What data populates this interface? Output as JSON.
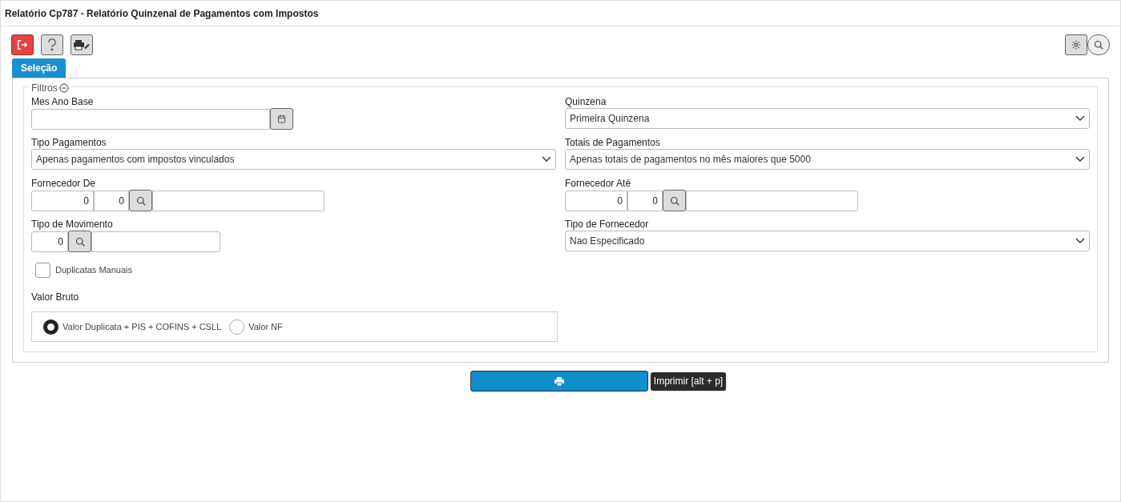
{
  "window": {
    "title": "Relatório Cp787 - Relatório Quinzenal de Pagamentos com Impostos"
  },
  "toolbar": [
    {
      "kind": "exit"
    },
    {
      "kind": "help"
    },
    {
      "kind": "printer-settings"
    }
  ],
  "toolbar_right": [
    {
      "kind": "settings"
    },
    {
      "kind": "search"
    }
  ],
  "tabs": [
    {
      "label": "Seleção",
      "selected": true
    }
  ],
  "filters": {
    "legend": "Filtros",
    "expanded": true,
    "rows": [
      [
        {
          "kind": "date",
          "label": "Mes Ano Base"
        },
        {
          "kind": "select",
          "label": "Quinzena",
          "value": "Primeira Quinzena"
        }
      ],
      [
        {
          "kind": "select",
          "label": "Tipo Pagamentos",
          "value": "Apenas pagamentos com impostos vinculados"
        },
        {
          "kind": "select",
          "label": "Totais de Pagamentos",
          "value": "Apenas totais de pagamentos no mês maiores que 5000"
        }
      ],
      [
        {
          "kind": "lookup2",
          "label": "Fornecedor De",
          "values": [
            "0",
            "0"
          ]
        },
        {
          "kind": "lookup2",
          "label": "Fornecedor Até",
          "values": [
            "0",
            "0"
          ]
        }
      ],
      [
        {
          "kind": "lookup1",
          "label": "Tipo de Movimento",
          "values": [
            "0"
          ]
        },
        {
          "kind": "select",
          "label": "Tipo de Fornecedor",
          "value": "Nao Especificado"
        }
      ]
    ],
    "checkbox": {
      "label": "Duplicatas Manuais",
      "checked": false
    },
    "radio_group": {
      "label": "Valor Bruto",
      "options": [
        {
          "label": "Valor Duplicata + PIS + COFINS + CSLL",
          "selected": true
        },
        {
          "label": "Valor NF",
          "selected": false
        }
      ]
    }
  },
  "print_button": {
    "tooltip": "Imprimir [alt + p]"
  }
}
